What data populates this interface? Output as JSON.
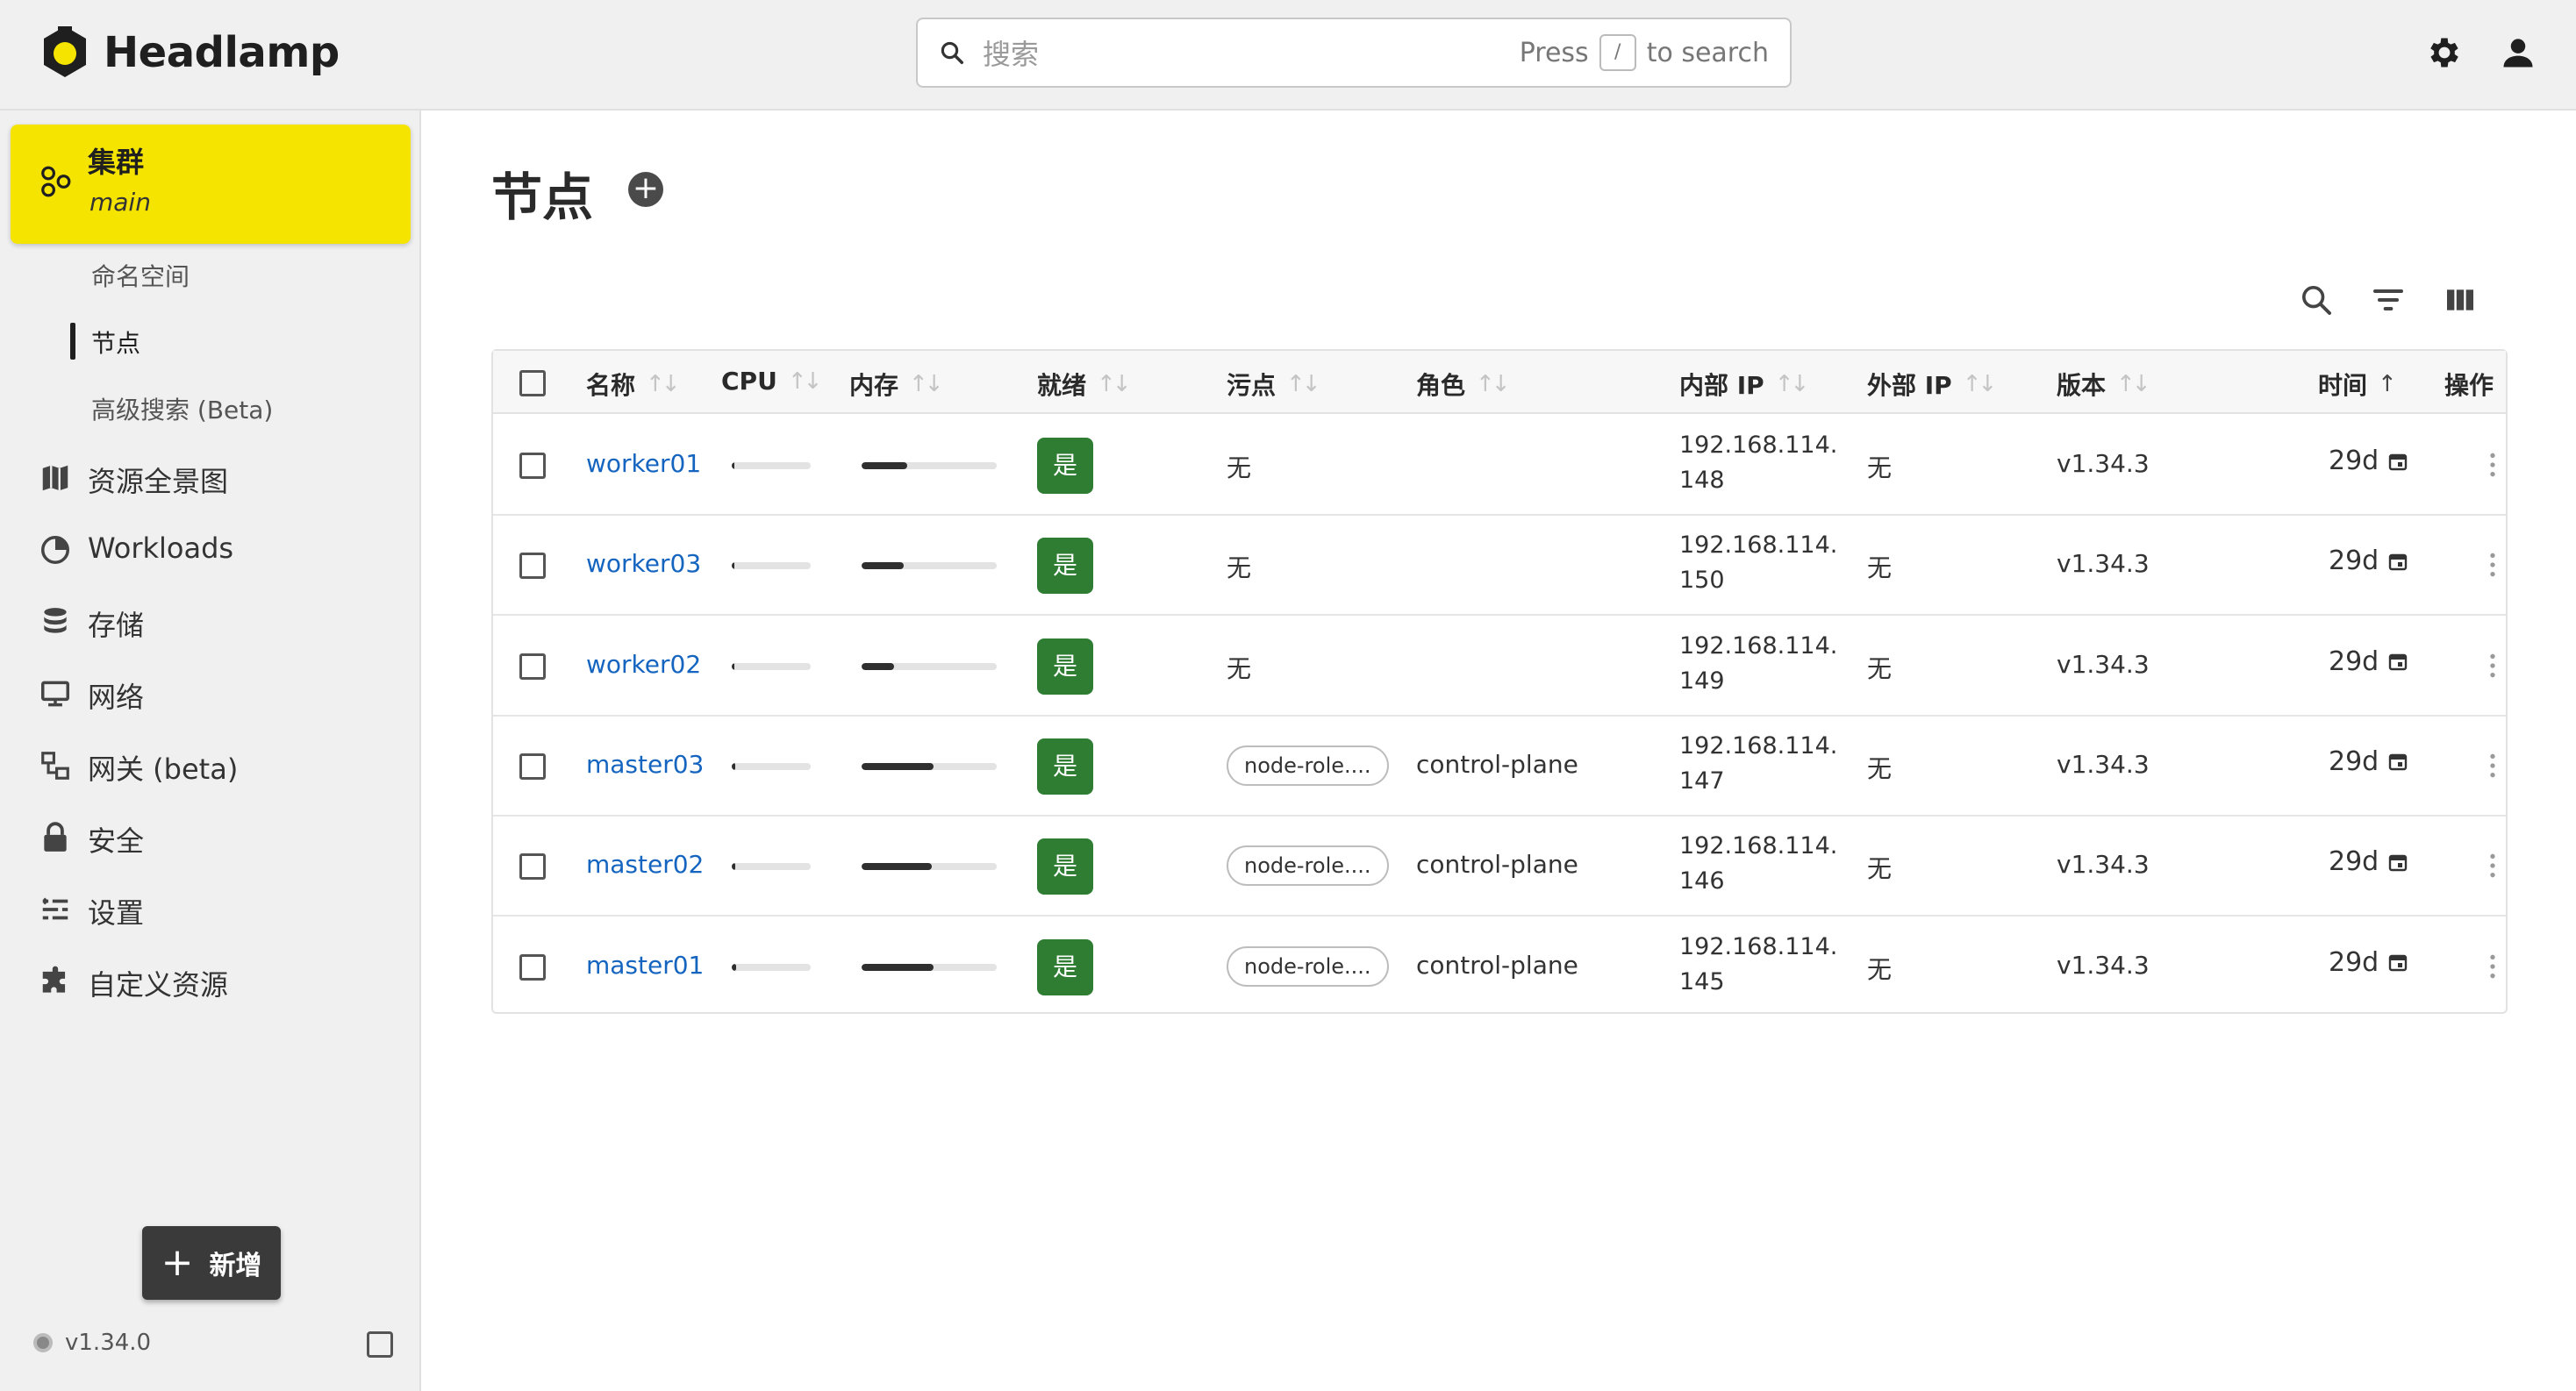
{
  "app": {
    "name": "Headlamp"
  },
  "search": {
    "placeholder": "搜索",
    "hint_prefix": "Press",
    "hint_key": "/",
    "hint_suffix": "to search"
  },
  "sidebar": {
    "cluster": {
      "label": "集群",
      "name": "main"
    },
    "subitems": [
      {
        "label": "命名空间",
        "active": false
      },
      {
        "label": "节点",
        "active": true
      },
      {
        "label": "高级搜索 (Beta)",
        "active": false
      }
    ],
    "items": [
      {
        "label": "资源全景图",
        "icon": "map-icon"
      },
      {
        "label": "Workloads",
        "icon": "workloads-icon"
      },
      {
        "label": "存储",
        "icon": "storage-icon"
      },
      {
        "label": "网络",
        "icon": "network-icon"
      },
      {
        "label": "网关 (beta)",
        "icon": "gateway-icon"
      },
      {
        "label": "安全",
        "icon": "lock-icon"
      },
      {
        "label": "设置",
        "icon": "settings-list-icon"
      },
      {
        "label": "自定义资源",
        "icon": "puzzle-icon"
      }
    ],
    "add_label": "新增",
    "version": "v1.34.0"
  },
  "page": {
    "title": "节点"
  },
  "table": {
    "columns": {
      "name": "名称",
      "cpu": "CPU",
      "memory": "内存",
      "ready": "就绪",
      "taints": "污点",
      "roles": "角色",
      "internal_ip": "内部 IP",
      "external_ip": "外部 IP",
      "version": "版本",
      "age": "时间",
      "actions": "操作"
    },
    "rows": [
      {
        "name": "worker01",
        "cpu": 0.02,
        "memory": 0.34,
        "ready": "是",
        "taints": "无",
        "taint_chip": false,
        "roles": "",
        "internal_ip": "192.168.114.148",
        "external_ip": "无",
        "version": "v1.34.3",
        "age": "29d"
      },
      {
        "name": "worker03",
        "cpu": 0.02,
        "memory": 0.31,
        "ready": "是",
        "taints": "无",
        "taint_chip": false,
        "roles": "",
        "internal_ip": "192.168.114.150",
        "external_ip": "无",
        "version": "v1.34.3",
        "age": "29d"
      },
      {
        "name": "worker02",
        "cpu": 0.02,
        "memory": 0.24,
        "ready": "是",
        "taints": "无",
        "taint_chip": false,
        "roles": "",
        "internal_ip": "192.168.114.149",
        "external_ip": "无",
        "version": "v1.34.3",
        "age": "29d"
      },
      {
        "name": "master03",
        "cpu": 0.04,
        "memory": 0.53,
        "ready": "是",
        "taints": "node-role....",
        "taint_chip": true,
        "roles": "control-plane",
        "internal_ip": "192.168.114.147",
        "external_ip": "无",
        "version": "v1.34.3",
        "age": "29d"
      },
      {
        "name": "master02",
        "cpu": 0.04,
        "memory": 0.52,
        "ready": "是",
        "taints": "node-role....",
        "taint_chip": true,
        "roles": "control-plane",
        "internal_ip": "192.168.114.146",
        "external_ip": "无",
        "version": "v1.34.3",
        "age": "29d"
      },
      {
        "name": "master01",
        "cpu": 0.05,
        "memory": 0.53,
        "ready": "是",
        "taints": "node-role....",
        "taint_chip": true,
        "roles": "control-plane",
        "internal_ip": "192.168.114.145",
        "external_ip": "无",
        "version": "v1.34.3",
        "age": "29d"
      }
    ]
  },
  "colors": {
    "accent": "#f5e400",
    "link": "#1565c0",
    "ready": "#2e7d32"
  }
}
